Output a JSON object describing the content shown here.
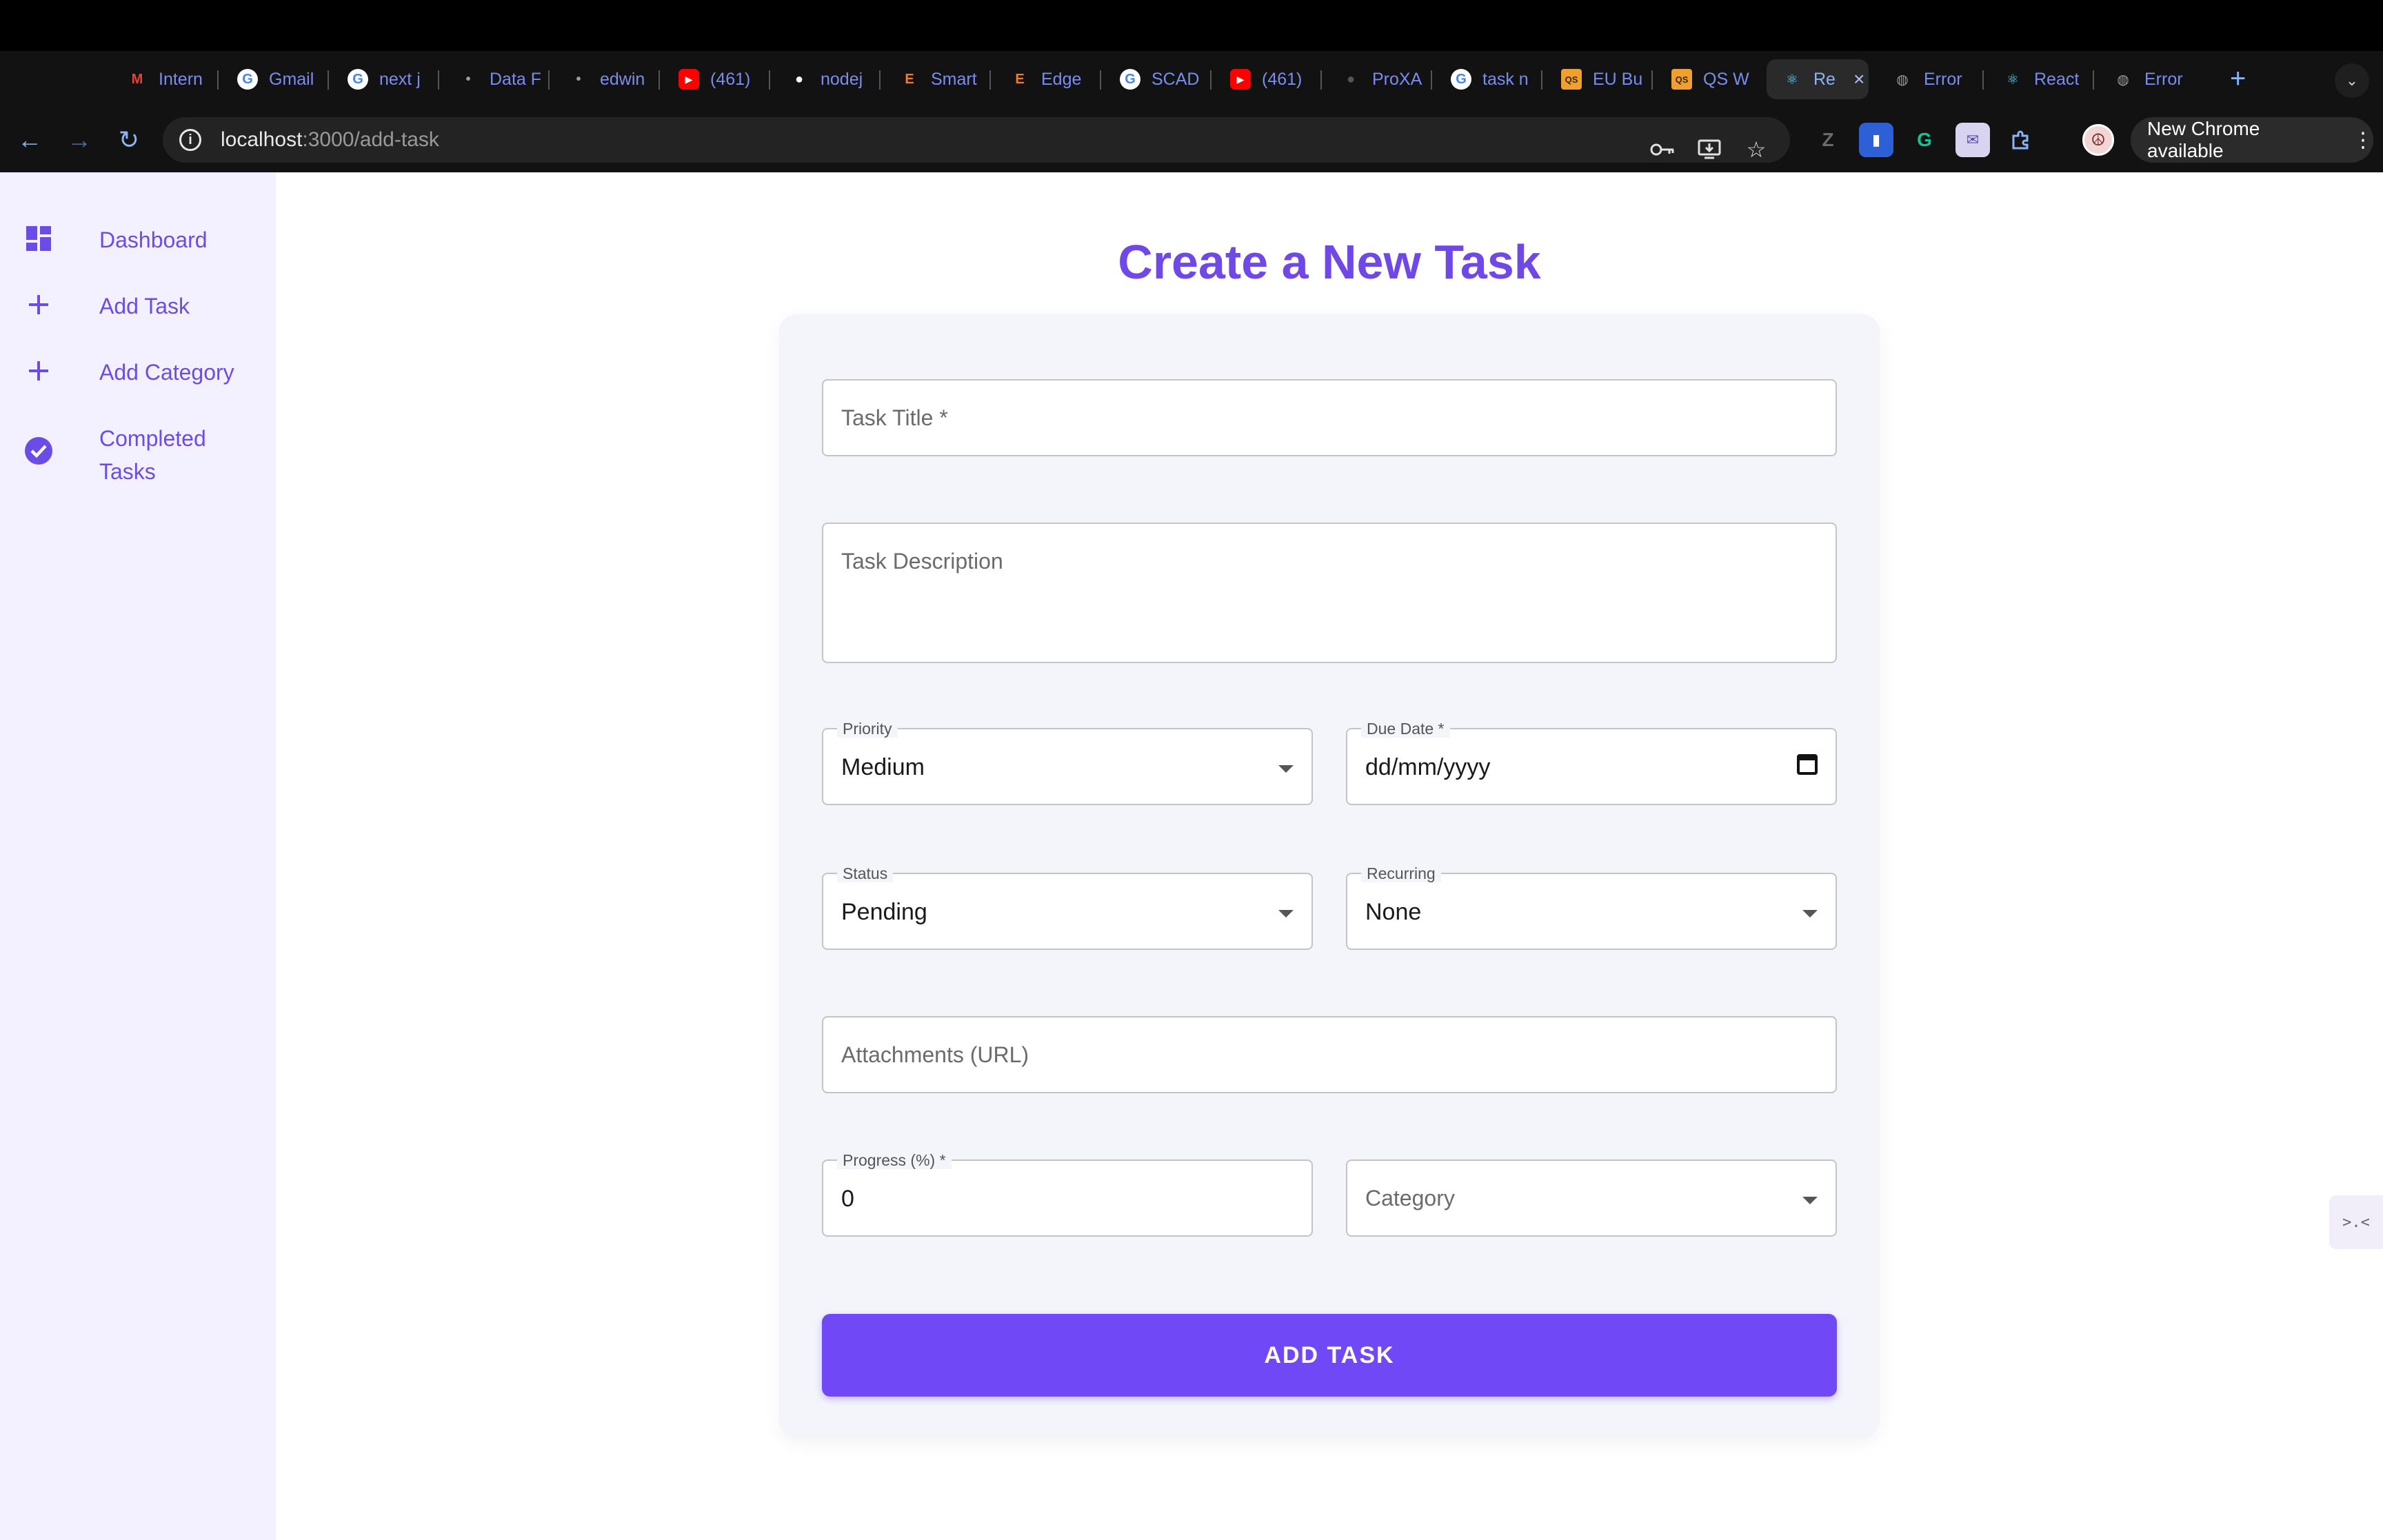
{
  "browser": {
    "tabs": [
      {
        "label": "Intern",
        "icon": "gmail-icon",
        "color": "#ea4335"
      },
      {
        "label": "Gmail",
        "icon": "google-icon",
        "color": "#4285f4"
      },
      {
        "label": "next j",
        "icon": "google-icon",
        "color": "#4285f4"
      },
      {
        "label": "Data F",
        "icon": "site-icon",
        "color": "#9e9e9e"
      },
      {
        "label": "edwin",
        "icon": "site-icon",
        "color": "#9e9e9e"
      },
      {
        "label": "(461)",
        "icon": "youtube-icon",
        "color": "#ff0000"
      },
      {
        "label": "nodej",
        "icon": "github-icon",
        "color": "#ffffff"
      },
      {
        "label": "Smart",
        "icon": "e-icon",
        "color": "#f47b20"
      },
      {
        "label": "Edge",
        "icon": "e-icon",
        "color": "#f47b20"
      },
      {
        "label": "SCAD",
        "icon": "google-icon",
        "color": "#4285f4"
      },
      {
        "label": "(461)",
        "icon": "youtube-icon",
        "color": "#ff0000"
      },
      {
        "label": "ProXA",
        "icon": "github-icon",
        "color": "#555555"
      },
      {
        "label": "task n",
        "icon": "google-icon",
        "color": "#4285f4"
      },
      {
        "label": "EU Bu",
        "icon": "qs-icon",
        "color": "#f0a030"
      },
      {
        "label": "QS W",
        "icon": "qs-icon",
        "color": "#f0a030"
      },
      {
        "label": "Re",
        "icon": "react-icon",
        "color": "#61dafb"
      },
      {
        "label": "Error",
        "icon": "globe-icon",
        "color": "#9e9e9e"
      },
      {
        "label": "React",
        "icon": "react-icon",
        "color": "#61dafb"
      },
      {
        "label": "Error",
        "icon": "globe-icon",
        "color": "#9e9e9e"
      }
    ],
    "active_tab_index": 15,
    "url_host": "localhost",
    "url_path": ":3000/add-task",
    "update_label": "New Chrome available"
  },
  "sidebar": {
    "items": [
      {
        "label": "Dashboard",
        "icon": "dashboard-icon"
      },
      {
        "label": "Add Task",
        "icon": "plus-icon"
      },
      {
        "label": "Add Category",
        "icon": "plus-icon"
      },
      {
        "label": "Completed Tasks",
        "icon": "check-circle-icon"
      }
    ]
  },
  "form": {
    "title": "Create a New Task",
    "task_title_placeholder": "Task Title *",
    "description_placeholder": "Task Description",
    "priority_label": "Priority",
    "priority_value": "Medium",
    "due_date_label": "Due Date *",
    "due_date_value": "dd/mm/yyyy",
    "status_label": "Status",
    "status_value": "Pending",
    "recurring_label": "Recurring",
    "recurring_value": "None",
    "attachments_placeholder": "Attachments (URL)",
    "progress_label": "Progress (%) *",
    "progress_value": "0",
    "category_placeholder": "Category",
    "submit_label": "ADD TASK"
  },
  "theme": {
    "accent": "#7148f5",
    "sidebar_bg": "#f3f0ff",
    "card_bg": "#f4f5fb"
  }
}
